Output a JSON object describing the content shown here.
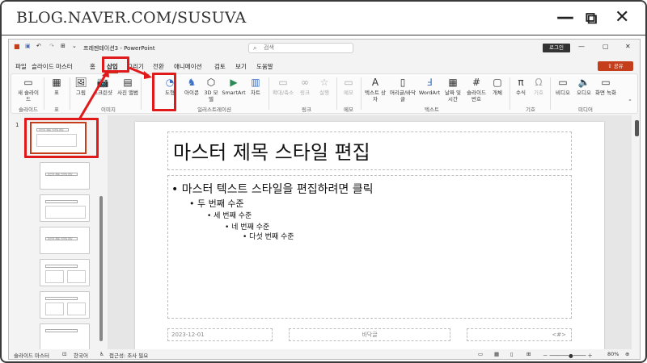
{
  "blog": {
    "url": "BLOG.NAVER.COM/SUSUVA",
    "minimize": "—",
    "restore": "⧉",
    "close": "✕"
  },
  "window": {
    "title": "프레젠테이션3 - PowerPoint",
    "search_placeholder": "검색",
    "login": "로그인",
    "min": "—",
    "max": "▢",
    "close": "✕"
  },
  "menu": {
    "items": [
      "파일",
      "슬라이드 마스터",
      "홈",
      "삽입",
      "그리기",
      "전환",
      "애니메이션",
      "검토",
      "보기",
      "도움말"
    ],
    "active": "삽입",
    "share": "공유"
  },
  "ribbon": {
    "buttons": [
      "새 슬라이드",
      "표",
      "그림",
      "스크린샷",
      "사진 앨범",
      "도형",
      "아이콘",
      "3D 모델",
      "SmartArt",
      "차트",
      "확대/축소",
      "링크",
      "실행",
      "메모",
      "텍스트 상자",
      "머리글/바닥글",
      "WordArt",
      "날짜 및 시간",
      "슬라이드 번호",
      "개체",
      "수식",
      "기호",
      "비디오",
      "오디오",
      "화면 녹화"
    ],
    "groups": [
      "슬라이드",
      "표",
      "이미지",
      "일러스트레이션",
      "링크",
      "메모",
      "텍스트",
      "기호",
      "미디어"
    ]
  },
  "thumbs": {
    "number": "1",
    "sel_title": "마스터 제목 스타일 편집",
    "t2": "마스터 제목 스타일 편집",
    "t3": "마스터 제목 스타일 편집"
  },
  "slide": {
    "title": "마스터 제목 스타일 편집",
    "levels": [
      "• 마스터 텍스트 스타일을 편집하려면 클릭",
      "• 두 번째 수준",
      "• 세 번째 수준",
      "• 네 번째 수준",
      "• 다섯 번째 수준"
    ],
    "footer_date": "2023-12-01",
    "footer_text": "바닥글",
    "footer_num": "<#>"
  },
  "status": {
    "mode": "슬라이드 마스터",
    "lang": "한국어",
    "access": "접근성: 조사 필요",
    "zoom": "80%"
  },
  "colors": {
    "accent": "#c43e1c",
    "highlight": "#e0191b"
  }
}
